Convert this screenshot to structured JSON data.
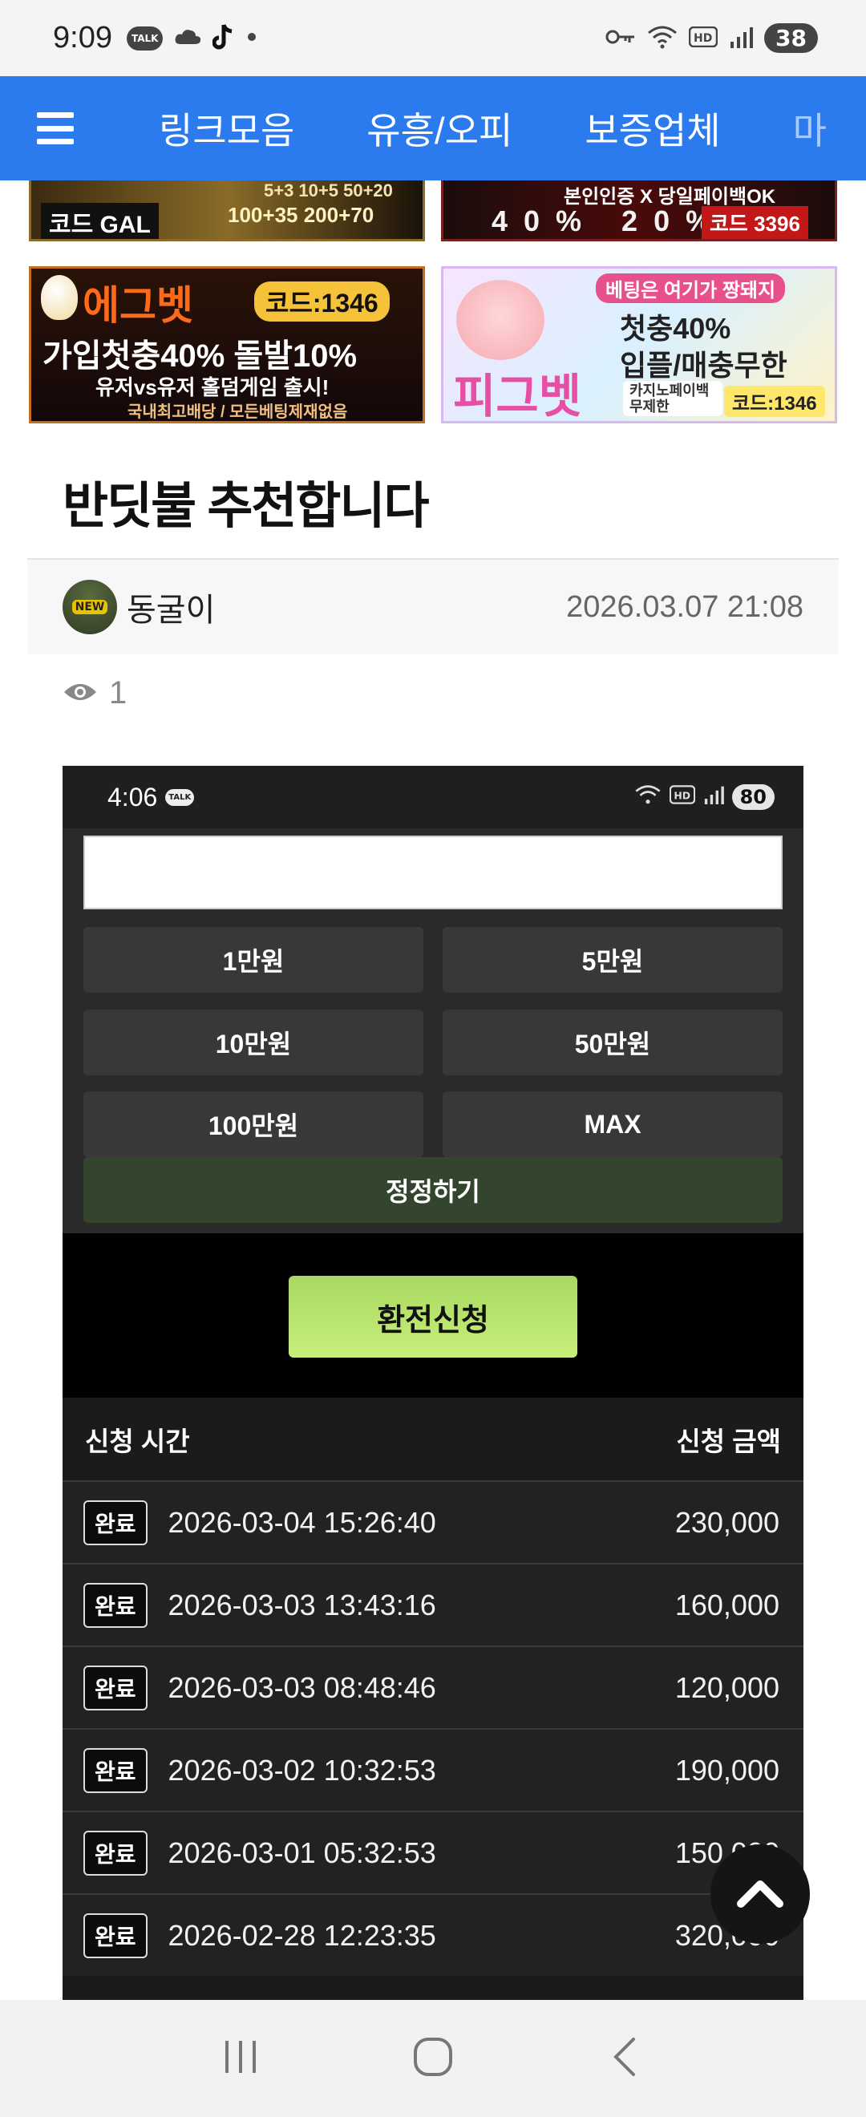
{
  "status_bar": {
    "time": "9:09",
    "battery": "38",
    "left_icons": [
      "talk-icon",
      "cloud-icon",
      "tiktok-icon",
      "dot-icon"
    ],
    "right_icons": [
      "key-icon",
      "wifi-icon",
      "hd-icon",
      "signal-icon"
    ]
  },
  "navbar": {
    "items": [
      "링크모음",
      "유흥/오피",
      "보증업체",
      "마"
    ]
  },
  "banners": {
    "top_left": {
      "line1": "5+3 10+5 50+20",
      "line2": "100+35 200+70",
      "code": "코드 GAL"
    },
    "top_right": {
      "line1": "본인인증 X 당일페이백OK",
      "line2": "40% 20%",
      "code": "코드 3396"
    },
    "mid_left": {
      "brand": "에그벳",
      "code": "코드:1346",
      "line1": "가입첫충40% 돌발10%",
      "line2": "유저vs유저 홀덤게임 출시!",
      "line3": "국내최고배당 / 모든베팅제재없음"
    },
    "mid_right": {
      "tag": "베팅은 여기가 짱돼지",
      "line1": "첫충40%",
      "line2": "입플/매충무한",
      "line3": "카지노페이백 무제한",
      "code": "코드:1346",
      "brand": "피그벳"
    }
  },
  "article": {
    "title": "반딧불 추천합니다",
    "author": "동굴이",
    "avatar_badge": "NEW",
    "date": "2026.03.07 21:08",
    "views": "1"
  },
  "screenshot": {
    "time": "4:06",
    "battery": "80",
    "amount_buttons": [
      "1만원",
      "5만원",
      "10만원",
      "50만원",
      "100만원",
      "MAX"
    ],
    "confirm_label": "정정하기",
    "apply_label": "환전신청",
    "table_headers": {
      "time": "신청 시간",
      "amount": "신청 금액"
    },
    "rows": [
      {
        "status": "완료",
        "time": "2026-03-04 15:26:40",
        "amount": "230,000"
      },
      {
        "status": "완료",
        "time": "2026-03-03 13:43:16",
        "amount": "160,000"
      },
      {
        "status": "완료",
        "time": "2026-03-03 08:48:46",
        "amount": "120,000"
      },
      {
        "status": "완료",
        "time": "2026-03-02 10:32:53",
        "amount": "190,000"
      },
      {
        "status": "완료",
        "time": "2026-03-01 05:32:53",
        "amount": "150,000"
      },
      {
        "status": "완료",
        "time": "2026-02-28 12:23:35",
        "amount": "320,000"
      }
    ]
  },
  "colors": {
    "nav_blue": "#2b7bef",
    "apply_green": "#b8e56c",
    "confirm_green": "#33452c"
  }
}
